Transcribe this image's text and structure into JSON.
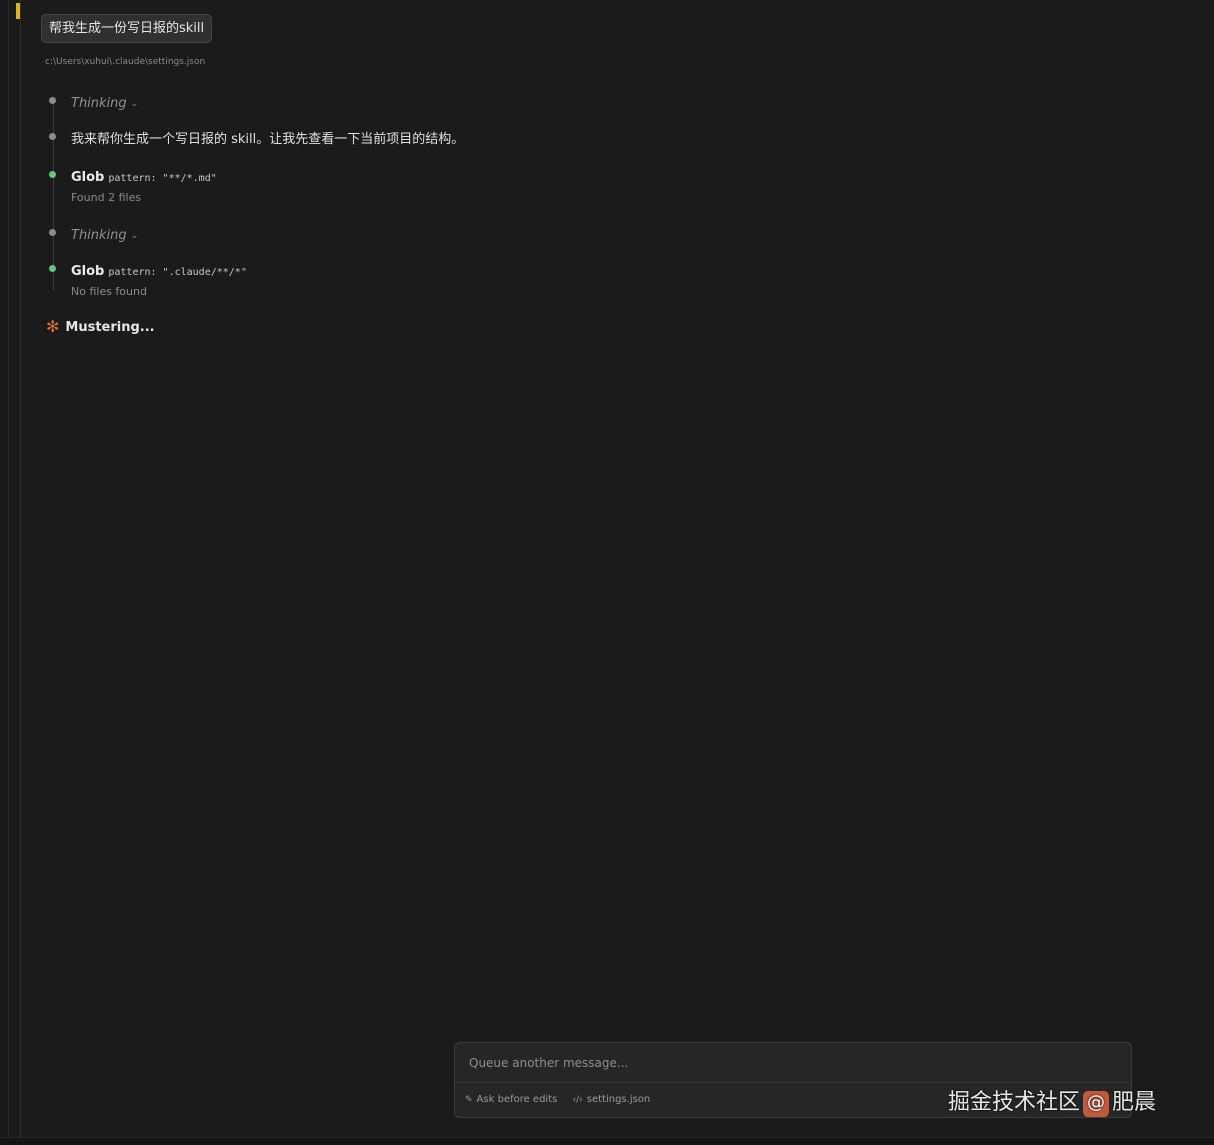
{
  "user_message": "帮我生成一份写日报的skill",
  "context_file_path": "c:\\Users\\xuhui\\.claude\\settings.json",
  "timeline": {
    "thinking_1": {
      "label": "Thinking",
      "chevron": "⌄"
    },
    "reply": {
      "text": "我来帮你生成一个写日报的 skill。让我先查看一下当前项目的结构。"
    },
    "glob_1": {
      "tool": "Glob",
      "param": "pattern: \"**/*.md\"",
      "result": "Found 2 files"
    },
    "thinking_2": {
      "label": "Thinking",
      "chevron": "⌄"
    },
    "glob_2": {
      "tool": "Glob",
      "param": "pattern: \".claude/**/*\"",
      "result": "No files found"
    }
  },
  "status": {
    "icon": "✻",
    "text": "Mustering..."
  },
  "composer": {
    "placeholder": "Queue another message...",
    "mode_label": "Ask before edits",
    "mode_icon": "✎",
    "file_label": "settings.json",
    "file_icon": "‹/›"
  },
  "watermark": {
    "left": "掘金技术社区",
    "at": "@",
    "right": "肥晨"
  },
  "colors": {
    "accent_cursor": "#d9b42a",
    "success_dot": "#6bc27a",
    "spark": "#d2703f",
    "background": "#1b1b1b"
  }
}
